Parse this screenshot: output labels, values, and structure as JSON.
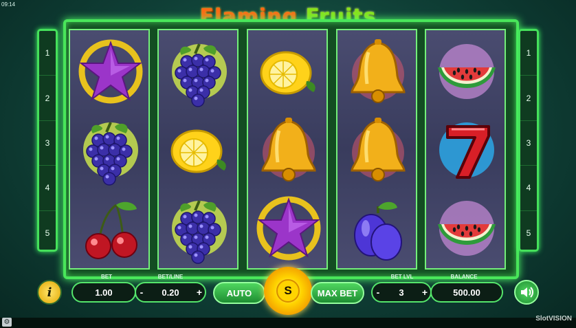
{
  "clock": "09:14",
  "title": {
    "part1": "Flaming",
    "part2": "Fruits"
  },
  "paylines_left": [
    "1",
    "2",
    "3",
    "4",
    "5"
  ],
  "paylines_right": [
    "1",
    "2",
    "3",
    "4",
    "5"
  ],
  "reels": [
    [
      "star",
      "grapes",
      "cherries"
    ],
    [
      "grapes",
      "lemon",
      "grapes"
    ],
    [
      "lemon",
      "bell",
      "star"
    ],
    [
      "bell",
      "bell",
      "plum"
    ],
    [
      "watermelon",
      "seven",
      "watermelon"
    ]
  ],
  "controls": {
    "bet_label": "BET",
    "bet_value": "1.00",
    "betline_label": "BET/LINE",
    "betline_value": "0.20",
    "minus": "-",
    "plus": "+",
    "auto_label": "AUTO",
    "spin_label": "S",
    "maxbet_label": "MAX BET",
    "betlvl_label": "BET LVL",
    "betlvl_value": "3",
    "balance_label": "BALANCE",
    "balance_value": "500.00",
    "info_label": "i"
  },
  "brand": "SlotVISION",
  "colors": {
    "accent": "#49e65a",
    "gold": "#ffd400",
    "reel_bg": "#44466a"
  }
}
